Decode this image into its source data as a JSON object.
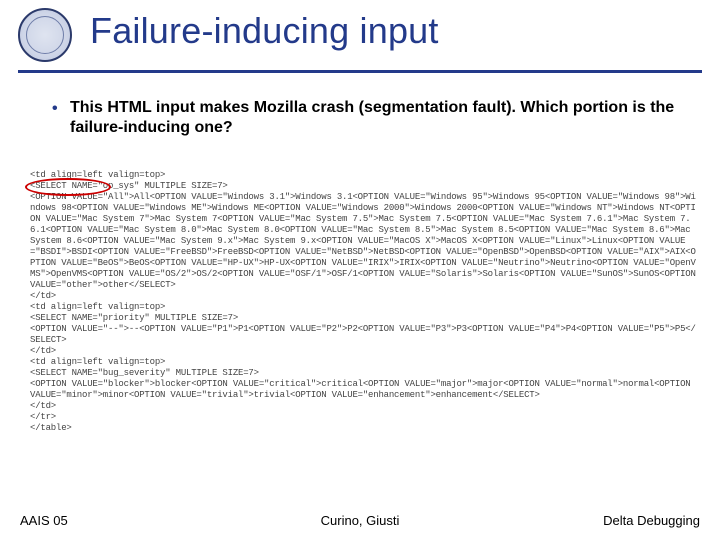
{
  "title": "Failure-inducing input",
  "bullet": "This HTML input makes Mozilla crash (segmentation fault). Which portion is the failure-inducing one?",
  "code_lines": [
    "<td align=left valign=top>",
    "<SELECT NAME=\"op_sys\" MULTIPLE SIZE=7>",
    "<OPTION VALUE=\"All\">All<OPTION VALUE=\"Windows 3.1\">Windows 3.1<OPTION VALUE=\"Windows 95\">Windows 95<OPTION VALUE=\"Windows 98\">Windows 98<OPTION VALUE=\"Windows ME\">Windows ME<OPTION VALUE=\"Windows 2000\">Windows 2000<OPTION VALUE=\"Windows NT\">Windows NT<OPTION VALUE=\"Mac System 7\">Mac System 7<OPTION VALUE=\"Mac System 7.5\">Mac System 7.5<OPTION VALUE=\"Mac System 7.6.1\">Mac System 7.6.1<OPTION VALUE=\"Mac System 8.0\">Mac System 8.0<OPTION VALUE=\"Mac System 8.5\">Mac System 8.5<OPTION VALUE=\"Mac System 8.6\">Mac System 8.6<OPTION VALUE=\"Mac System 9.x\">Mac System 9.x<OPTION VALUE=\"MacOS X\">MacOS X<OPTION VALUE=\"Linux\">Linux<OPTION VALUE=\"BSDI\">BSDI<OPTION VALUE=\"FreeBSD\">FreeBSD<OPTION VALUE=\"NetBSD\">NetBSD<OPTION VALUE=\"OpenBSD\">OpenBSD<OPTION VALUE=\"AIX\">AIX<OPTION VALUE=\"BeOS\">BeOS<OPTION VALUE=\"HP-UX\">HP-UX<OPTION VALUE=\"IRIX\">IRIX<OPTION VALUE=\"Neutrino\">Neutrino<OPTION VALUE=\"OpenVMS\">OpenVMS<OPTION VALUE=\"OS/2\">OS/2<OPTION VALUE=\"OSF/1\">OSF/1<OPTION VALUE=\"Solaris\">Solaris<OPTION VALUE=\"SunOS\">SunOS<OPTION VALUE=\"other\">other</SELECT>",
    "</td>",
    "<td align=left valign=top>",
    "<SELECT NAME=\"priority\" MULTIPLE SIZE=7>",
    "<OPTION VALUE=\"--\">--<OPTION VALUE=\"P1\">P1<OPTION VALUE=\"P2\">P2<OPTION VALUE=\"P3\">P3<OPTION VALUE=\"P4\">P4<OPTION VALUE=\"P5\">P5</SELECT>",
    "</td>",
    "<td align=left valign=top>",
    "<SELECT NAME=\"bug_severity\" MULTIPLE SIZE=7>",
    "<OPTION VALUE=\"blocker\">blocker<OPTION VALUE=\"critical\">critical<OPTION VALUE=\"major\">major<OPTION VALUE=\"normal\">normal<OPTION VALUE=\"minor\">minor<OPTION VALUE=\"trivial\">trivial<OPTION VALUE=\"enhancement\">enhancement</SELECT>",
    "</td>",
    "</tr>",
    "</table>"
  ],
  "footer": {
    "left": "AAIS 05",
    "center": "Curino, Giusti",
    "right": "Delta Debugging"
  }
}
